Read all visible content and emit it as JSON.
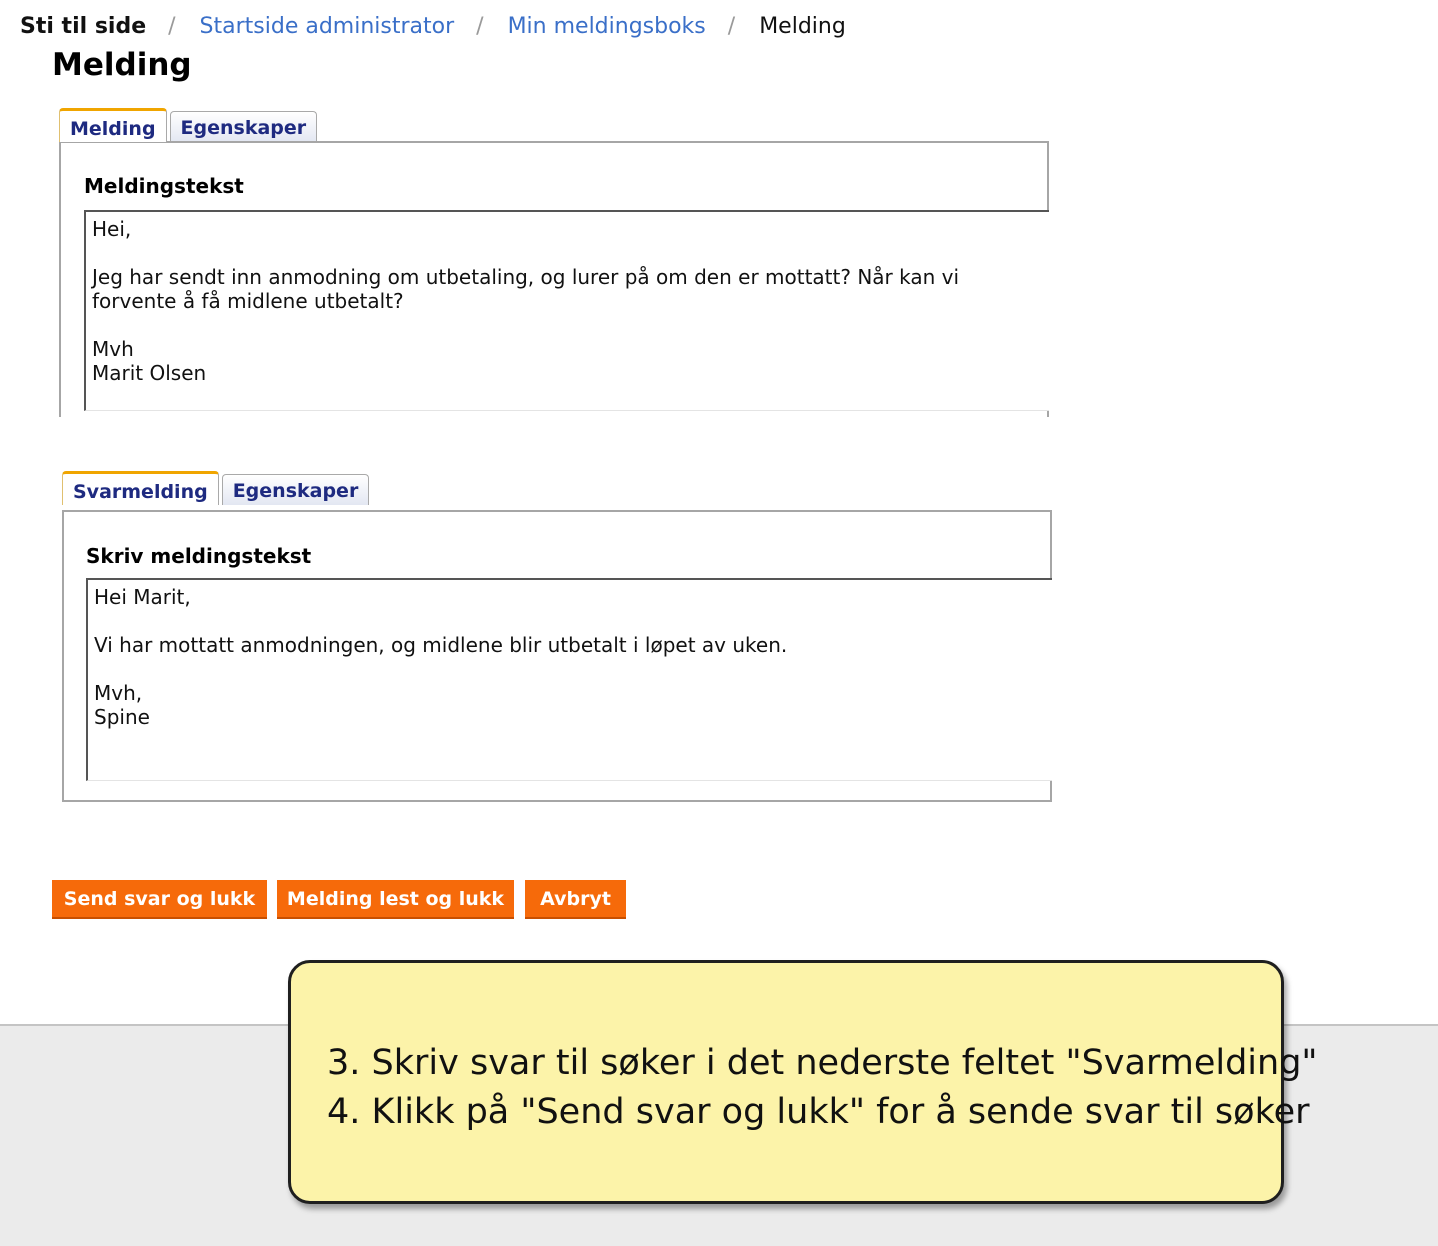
{
  "breadcrumb": {
    "label": "Sti til side",
    "separator": "/",
    "items": [
      "Startside administrator",
      "Min meldingsboks"
    ],
    "current": "Melding"
  },
  "page_title": "Melding",
  "received": {
    "tabs": [
      "Melding",
      "Egenskaper"
    ],
    "heading": "Meldingstekst",
    "text": "Hei,\n\nJeg har sendt inn anmodning om utbetaling, og lurer på om den er mottatt? Når kan vi forvente å få midlene utbetalt?\n\nMvh\nMarit Olsen"
  },
  "reply": {
    "tabs": [
      "Svarmelding",
      "Egenskaper"
    ],
    "heading": "Skriv meldingstekst",
    "text": "Hei Marit,\n\nVi har mottatt anmodningen, og midlene blir utbetalt i løpet av uken.\n\nMvh,\nSpine"
  },
  "buttons": {
    "send": "Send svar og lukk",
    "read": "Melding lest og lukk",
    "cancel": "Avbryt"
  },
  "callout": {
    "line1": "3. Skriv svar til søker i det nederste feltet \"Svarmelding\"",
    "line2": "4. Klikk på \"Send svar og lukk\" for å sende svar til søker"
  },
  "colors": {
    "button": "#f66a0a",
    "link": "#3a6fc8",
    "tab_text": "#1e2a80",
    "tab_active_accent": "#f0a500",
    "callout_bg": "#fcf3a9"
  }
}
